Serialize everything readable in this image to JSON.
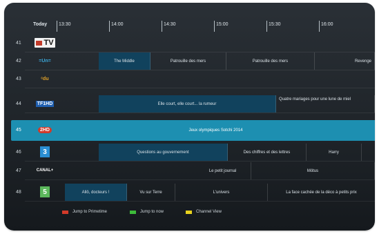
{
  "header": {
    "today": "Today",
    "times": [
      "13:30",
      "14:00",
      "14:30",
      "15:00",
      "15:30",
      "16:00"
    ]
  },
  "channels": [
    {
      "num": "41",
      "logo": "TV",
      "programs": []
    },
    {
      "num": "42",
      "logo": "=Un=",
      "programs": [
        "The Middle",
        "Patrouille des mers",
        "Patrouille des mers",
        "Revenge"
      ]
    },
    {
      "num": "43",
      "logo": "ᶜdu",
      "programs": []
    },
    {
      "num": "44",
      "logo": "TF1HD",
      "programs": [
        "Elle court, elle court... la rumeur",
        "Quatre mariages pour une lune de miel"
      ]
    },
    {
      "num": "45",
      "logo": "2HD",
      "programs": [
        "Jeux olympiques Sotchi 2014"
      ]
    },
    {
      "num": "46",
      "logo": "3",
      "programs": [
        "Questions au gouvernement",
        "Des chiffres et des lettres",
        "Harry"
      ]
    },
    {
      "num": "47",
      "logo": "CANAL+",
      "programs": [
        "Le petit journal",
        "Mötus"
      ]
    },
    {
      "num": "48",
      "logo": "5",
      "programs": [
        "Allô, docteurs !",
        "Vu sur Terre",
        "L'univers",
        "La face cachée de la déco à petits prix"
      ]
    }
  ],
  "legend": [
    {
      "label": "Jump to Primetime",
      "color": "#d23a2a"
    },
    {
      "label": "Jump to now",
      "color": "#3dbb3a"
    },
    {
      "label": "Channel View",
      "color": "#e8d21e"
    }
  ],
  "colors": {
    "selected_row": "#1d8fb1",
    "current_program": "#11425d",
    "frame": "#1e2328"
  },
  "icons": [
    "tv-channel-logo",
    "un-channel-logo",
    "dux-channel-logo",
    "tf1-channel-logo",
    "france2-channel-logo",
    "france3-channel-logo",
    "canal-plus-channel-logo",
    "france5-channel-logo"
  ]
}
